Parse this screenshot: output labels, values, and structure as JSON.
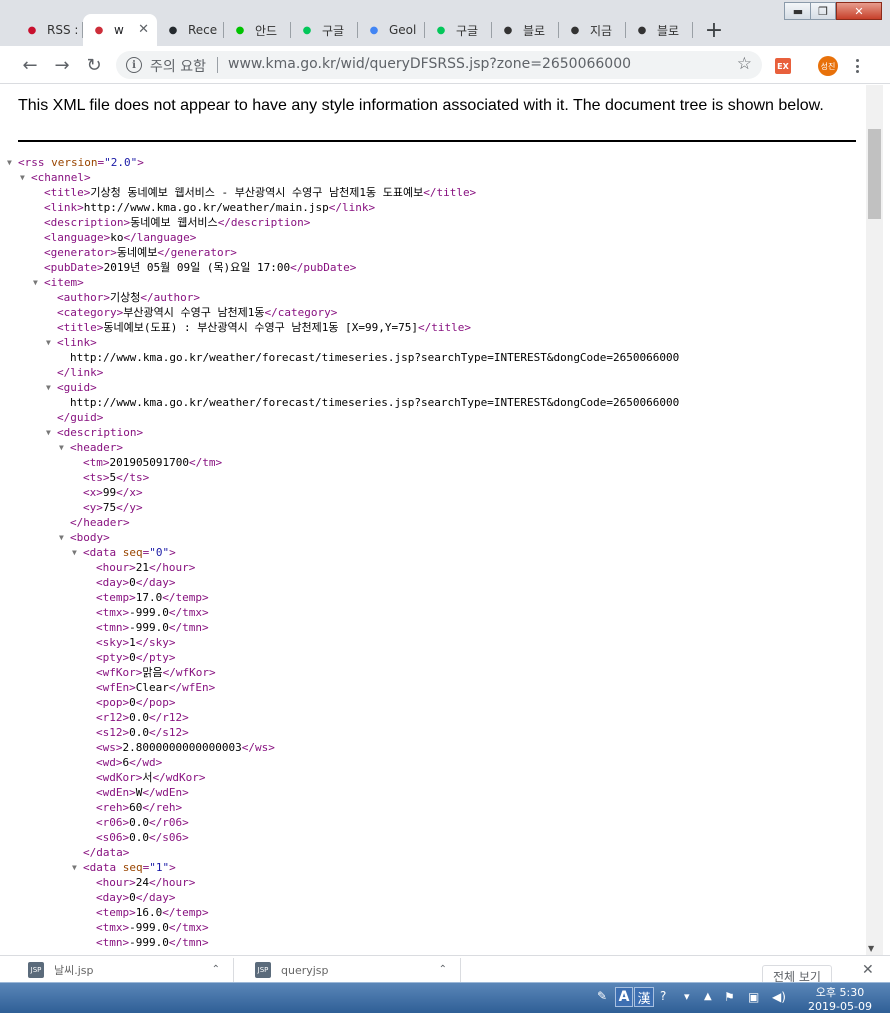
{
  "tabs": [
    {
      "title": "RSS :",
      "icon": "korea-gov-icon",
      "color": "#c8102e"
    },
    {
      "title": "w",
      "icon": "korea-flag-icon",
      "color": "#cd2e3a",
      "active": true
    },
    {
      "title": "Rece",
      "icon": "github-icon",
      "color": "#24292e"
    },
    {
      "title": "안드",
      "icon": "line-icon",
      "color": "#00c300"
    },
    {
      "title": "구글",
      "icon": "naver-icon",
      "color": "#03c75a"
    },
    {
      "title": "Geol",
      "icon": "google-cloud-icon",
      "color": "#4285f4"
    },
    {
      "title": "구글",
      "icon": "naver-blog-icon",
      "color": "#03c75a"
    },
    {
      "title": "블로",
      "icon": "tistory-icon",
      "color": "#333333"
    },
    {
      "title": "지금",
      "icon": "tistory-icon",
      "color": "#333333"
    },
    {
      "title": "블로",
      "icon": "tistory-icon",
      "color": "#333333"
    }
  ],
  "toolbar": {
    "security_label": "주의 요함",
    "url": "www.kma.go.kr/wid/queryDFSRSS.jsp?zone=2650066000",
    "profile_label": "성진"
  },
  "notice": "This XML file does not appear to have any style information associated with it. The document tree is shown below.",
  "xml_lines": [
    {
      "indent": 0,
      "toggle": true,
      "html": "<span class=\"tg\">&lt;rss</span> <span class=\"at\">version</span><span class=\"tg\">=</span><span class=\"av\">\"2.0\"</span><span class=\"tg\">&gt;</span>"
    },
    {
      "indent": 1,
      "toggle": true,
      "tag": "channel",
      "kind": "open"
    },
    {
      "indent": 2,
      "tag": "title",
      "text": "기상청 동네예보 웹서비스 - 부산광역시 수영구 남천제1동 도표예보"
    },
    {
      "indent": 2,
      "tag": "link",
      "text": "http://www.kma.go.kr/weather/main.jsp"
    },
    {
      "indent": 2,
      "tag": "description",
      "text": "동네예보 웹서비스"
    },
    {
      "indent": 2,
      "tag": "language",
      "text": "ko"
    },
    {
      "indent": 2,
      "tag": "generator",
      "text": "동네예보"
    },
    {
      "indent": 2,
      "tag": "pubDate",
      "text": "2019년 05월 09일 (목)요일 17:00"
    },
    {
      "indent": 2,
      "toggle": true,
      "tag": "item",
      "kind": "open"
    },
    {
      "indent": 3,
      "tag": "author",
      "text": "기상청"
    },
    {
      "indent": 3,
      "tag": "category",
      "text": "부산광역시 수영구 남천제1동"
    },
    {
      "indent": 3,
      "tag": "title",
      "text": "동네예보(도표) : 부산광역시 수영구 남천제1동 [X=99,Y=75]"
    },
    {
      "indent": 3,
      "toggle": true,
      "tag": "link",
      "kind": "open"
    },
    {
      "indent": 4,
      "kind": "plain",
      "text": "http://www.kma.go.kr/weather/forecast/timeseries.jsp?searchType=INTEREST&dongCode=2650066000"
    },
    {
      "indent": 3,
      "tag": "link",
      "kind": "close"
    },
    {
      "indent": 3,
      "toggle": true,
      "tag": "guid",
      "kind": "open"
    },
    {
      "indent": 4,
      "kind": "plain",
      "text": "http://www.kma.go.kr/weather/forecast/timeseries.jsp?searchType=INTEREST&dongCode=2650066000"
    },
    {
      "indent": 3,
      "tag": "guid",
      "kind": "close"
    },
    {
      "indent": 3,
      "toggle": true,
      "tag": "description",
      "kind": "open"
    },
    {
      "indent": 4,
      "toggle": true,
      "tag": "header",
      "kind": "open"
    },
    {
      "indent": 5,
      "tag": "tm",
      "text": "201905091700"
    },
    {
      "indent": 5,
      "tag": "ts",
      "text": "5"
    },
    {
      "indent": 5,
      "tag": "x",
      "text": "99"
    },
    {
      "indent": 5,
      "tag": "y",
      "text": "75"
    },
    {
      "indent": 4,
      "tag": "header",
      "kind": "close"
    },
    {
      "indent": 4,
      "toggle": true,
      "tag": "body",
      "kind": "open"
    },
    {
      "indent": 5,
      "toggle": true,
      "html": "<span class=\"tg\">&lt;data</span> <span class=\"at\">seq</span><span class=\"tg\">=</span><span class=\"av\">\"0\"</span><span class=\"tg\">&gt;</span>"
    },
    {
      "indent": 6,
      "tag": "hour",
      "text": "21"
    },
    {
      "indent": 6,
      "tag": "day",
      "text": "0"
    },
    {
      "indent": 6,
      "tag": "temp",
      "text": "17.0"
    },
    {
      "indent": 6,
      "tag": "tmx",
      "text": "-999.0"
    },
    {
      "indent": 6,
      "tag": "tmn",
      "text": "-999.0"
    },
    {
      "indent": 6,
      "tag": "sky",
      "text": "1"
    },
    {
      "indent": 6,
      "tag": "pty",
      "text": "0"
    },
    {
      "indent": 6,
      "tag": "wfKor",
      "text": "맑음"
    },
    {
      "indent": 6,
      "tag": "wfEn",
      "text": "Clear"
    },
    {
      "indent": 6,
      "tag": "pop",
      "text": "0"
    },
    {
      "indent": 6,
      "tag": "r12",
      "text": "0.0"
    },
    {
      "indent": 6,
      "tag": "s12",
      "text": "0.0"
    },
    {
      "indent": 6,
      "tag": "ws",
      "text": "2.8000000000000003"
    },
    {
      "indent": 6,
      "tag": "wd",
      "text": "6"
    },
    {
      "indent": 6,
      "tag": "wdKor",
      "text": "서"
    },
    {
      "indent": 6,
      "tag": "wdEn",
      "text": "W"
    },
    {
      "indent": 6,
      "tag": "reh",
      "text": "60"
    },
    {
      "indent": 6,
      "tag": "r06",
      "text": "0.0"
    },
    {
      "indent": 6,
      "tag": "s06",
      "text": "0.0"
    },
    {
      "indent": 5,
      "tag": "data",
      "kind": "close"
    },
    {
      "indent": 5,
      "toggle": true,
      "html": "<span class=\"tg\">&lt;data</span> <span class=\"at\">seq</span><span class=\"tg\">=</span><span class=\"av\">\"1\"</span><span class=\"tg\">&gt;</span>"
    },
    {
      "indent": 6,
      "tag": "hour",
      "text": "24"
    },
    {
      "indent": 6,
      "tag": "day",
      "text": "0"
    },
    {
      "indent": 6,
      "tag": "temp",
      "text": "16.0"
    },
    {
      "indent": 6,
      "tag": "tmx",
      "text": "-999.0"
    },
    {
      "indent": 6,
      "tag": "tmn",
      "text": "-999.0"
    }
  ],
  "downloads": {
    "items": [
      {
        "label": "날씨.jsp"
      },
      {
        "label": "queryjsp"
      }
    ],
    "show_all_label": "전체 보기"
  },
  "taskbar": {
    "ime_mode": "A",
    "ime_hanja": "漢",
    "time": "오후 5:30",
    "date": "2019-05-09"
  }
}
